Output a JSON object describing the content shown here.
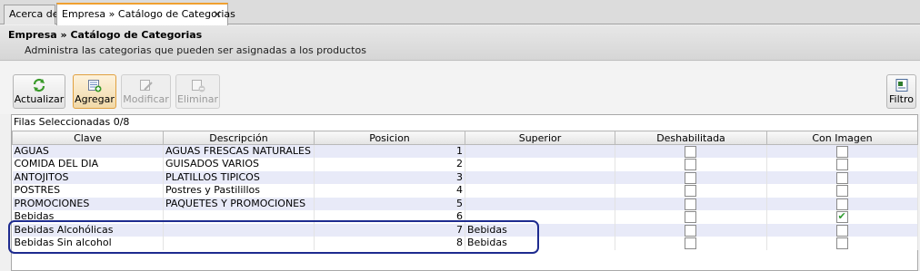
{
  "tabs": [
    {
      "label": "Acerca de"
    },
    {
      "label": "Empresa » Catálogo de Categorias",
      "close": "✕"
    }
  ],
  "header": {
    "title": "Empresa » Catálogo de Categorias",
    "subtitle": "Administra las categorias que pueden ser asignadas a los productos"
  },
  "toolbar": {
    "actualizar": "Actualizar",
    "agregar": "Agregar",
    "modificar": "Modificar",
    "eliminar": "Eliminar",
    "filtro": "Filtro"
  },
  "grid": {
    "selection_info": "Filas Seleccionadas  0/8",
    "columns": [
      "Clave",
      "Descripción",
      "Posicion",
      "Superior",
      "Deshabilitada",
      "Con Imagen"
    ],
    "rows": [
      {
        "clave": "AGUAS",
        "descripcion": "AGUAS FRESCAS NATURALES",
        "posicion": "1",
        "superior": "",
        "deshabilitada": false,
        "con_imagen": false
      },
      {
        "clave": "COMIDA DEL DIA",
        "descripcion": "GUISADOS VARIOS",
        "posicion": "2",
        "superior": "",
        "deshabilitada": false,
        "con_imagen": false
      },
      {
        "clave": "ANTOJITOS",
        "descripcion": "PLATILLOS TIPICOS",
        "posicion": "3",
        "superior": "",
        "deshabilitada": false,
        "con_imagen": false
      },
      {
        "clave": "POSTRES",
        "descripcion": "Postres y Pastilillos",
        "posicion": "4",
        "superior": "",
        "deshabilitada": false,
        "con_imagen": false
      },
      {
        "clave": "PROMOCIONES",
        "descripcion": "PAQUETES Y PROMOCIONES",
        "posicion": "5",
        "superior": "",
        "deshabilitada": false,
        "con_imagen": false
      },
      {
        "clave": "Bebidas",
        "descripcion": "",
        "posicion": "6",
        "superior": "",
        "deshabilitada": false,
        "con_imagen": true
      },
      {
        "clave": "Bebidas Alcohólicas",
        "descripcion": "",
        "posicion": "7",
        "superior": "Bebidas",
        "deshabilitada": false,
        "con_imagen": false
      },
      {
        "clave": "Bebidas Sin alcohol",
        "descripcion": "",
        "posicion": "8",
        "superior": "Bebidas",
        "deshabilitada": false,
        "con_imagen": false
      }
    ]
  },
  "colors": {
    "highlight": "#1e2b8f",
    "row_alt": "#e8eaf8",
    "active_tab": "#f0a030",
    "check": "#2e9b2e"
  },
  "icons": {
    "actualizar": "refresh-icon",
    "agregar": "add-record-icon",
    "modificar": "edit-record-icon",
    "eliminar": "delete-record-icon",
    "filtro": "filter-icon"
  }
}
